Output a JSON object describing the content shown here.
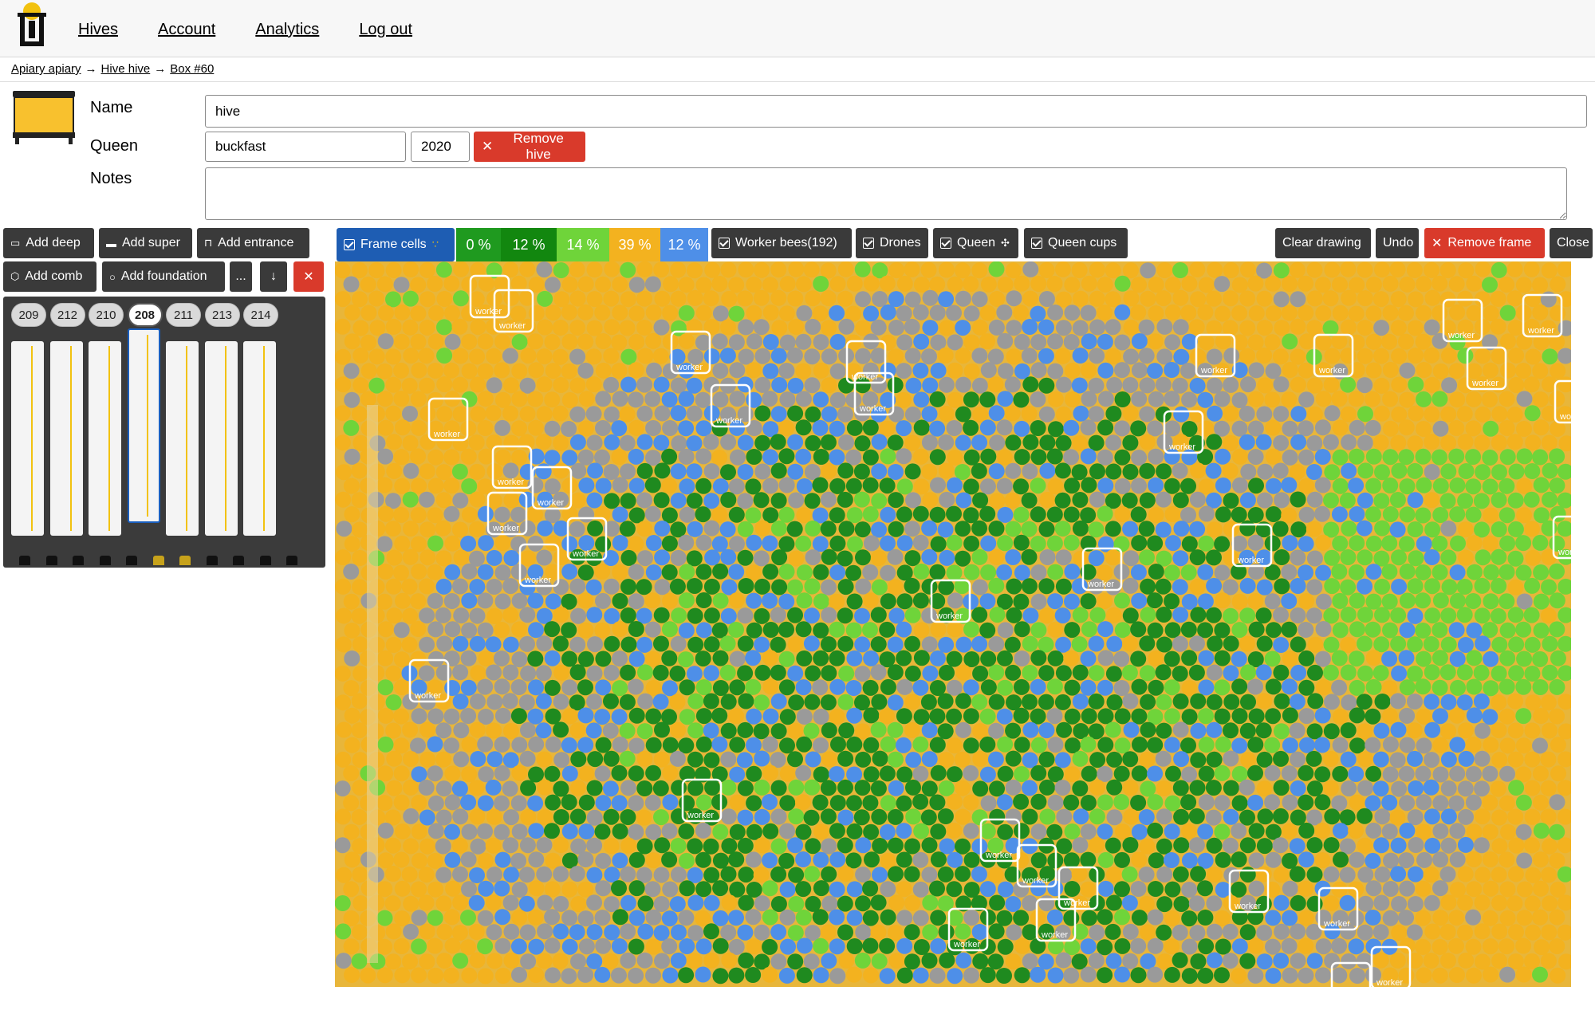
{
  "nav": {
    "items": [
      "Hives",
      "Account",
      "Analytics",
      "Log out"
    ]
  },
  "breadcrumb": {
    "apiary": "Apiary apiary",
    "hive": "Hive hive",
    "box": "Box #60",
    "separator": "→"
  },
  "form": {
    "name_label": "Name",
    "name_value": "hive",
    "queen_label": "Queen",
    "queen_race": "buckfast",
    "queen_year": "2020",
    "remove_hive": "Remove hive",
    "notes_label": "Notes",
    "notes_value": ""
  },
  "box_toolbar": {
    "add_deep": "Add deep",
    "add_super": "Add super",
    "add_entrance": "Add entrance",
    "add_comb": "Add comb",
    "add_foundation": "Add foundation",
    "more": "...",
    "move_down": "↓",
    "remove": "✕"
  },
  "frames": {
    "numbers": [
      "209",
      "212",
      "210",
      "208",
      "211",
      "213",
      "214"
    ],
    "active": "208"
  },
  "frame_toolbar": {
    "frame_cells": "Frame cells",
    "percentages": [
      {
        "value": "0 %",
        "color": "#1f9a1f"
      },
      {
        "value": "12 %",
        "color": "#12870f"
      },
      {
        "value": "14 %",
        "color": "#6fd43a"
      },
      {
        "value": "39 %",
        "color": "#f3b21f"
      },
      {
        "value": "12 %",
        "color": "#4e8fe8"
      }
    ],
    "worker_bees": "Worker bees(192)",
    "drones": "Drones",
    "queen": "Queen",
    "queen_cups": "Queen cups",
    "clear_drawing": "Clear drawing",
    "undo": "Undo",
    "remove_frame": "Remove frame",
    "close": "Close"
  },
  "detection_label": "worker",
  "colors": {
    "danger": "#d93a2b",
    "toolbar": "#3a3a3a",
    "honey": "#f3b21f",
    "brood_capped": "#9a9a9a",
    "eggs": "#4e8fe8",
    "larvae": "#1f8a1f",
    "pollen": "#6fd43a"
  }
}
